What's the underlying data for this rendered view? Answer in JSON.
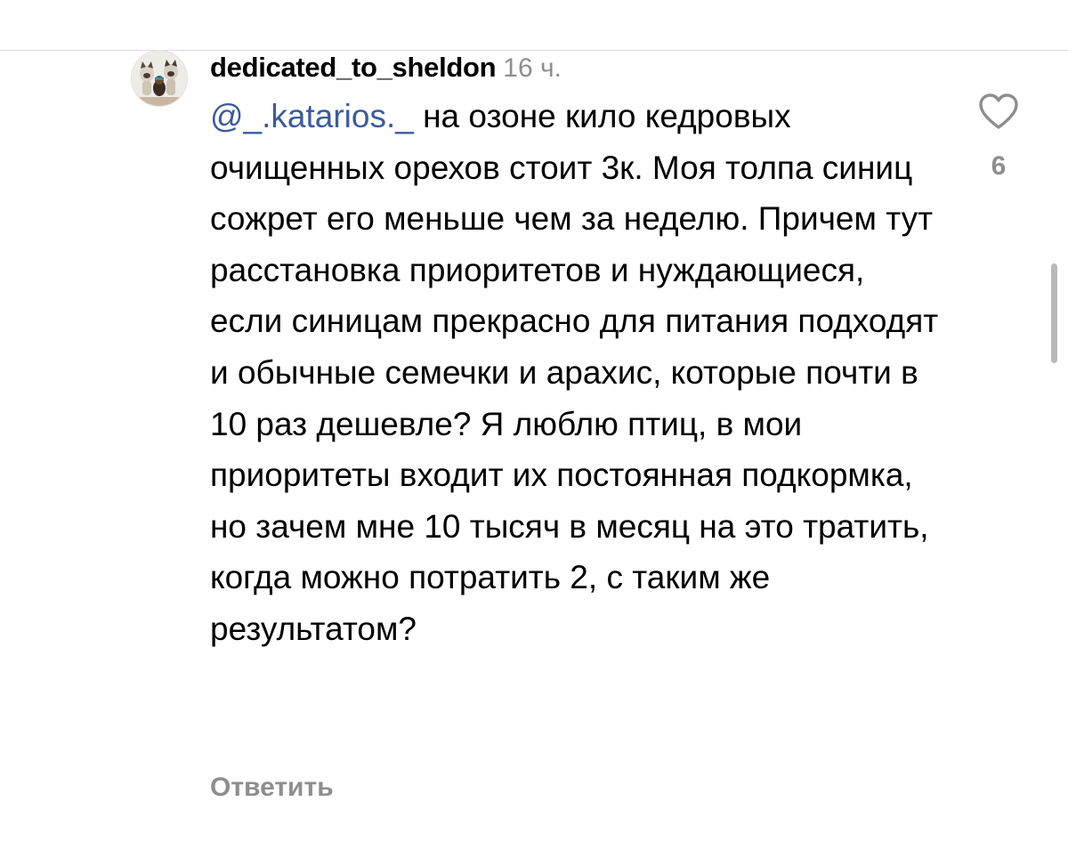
{
  "comment": {
    "username": "dedicated_to_sheldon",
    "timestamp": "16 ч.",
    "mention": "@_.katarios._",
    "text": " на озоне кило кедровых очищенных орехов стоит 3к. Моя толпа синиц сожрет его меньше чем за неделю. Причем тут расстановка приоритетов и нуждающиеся, если синицам прекрасно для питания подходят и обычные семечки и арахис, которые почти в 10 раз дешевле? Я люблю птиц, в мои приоритеты входит их постоянная подкормка, но зачем мне 10 тысяч в месяц на это тратить, когда можно потратить 2, с таким же результатом?",
    "reply_label": "Ответить",
    "like_count": "6"
  },
  "icons": {
    "like": "heart-outline-icon",
    "avatar": "avatar-cats-image"
  },
  "colors": {
    "mention": "#3b5b9c",
    "secondary_text": "#8e8e8e",
    "divider": "#dbdbdb"
  }
}
